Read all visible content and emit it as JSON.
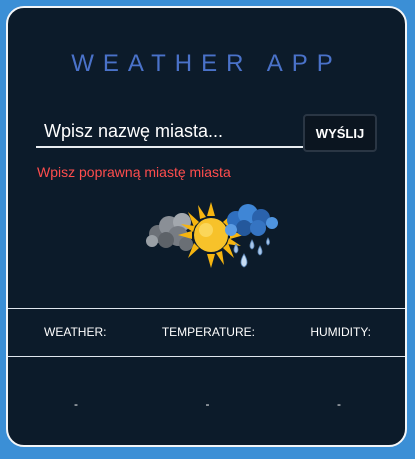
{
  "app": {
    "title": "WEATHER APP"
  },
  "search": {
    "placeholder": "Wpisz nazwę miasta...",
    "value": "",
    "button_label": "WYŚLIJ"
  },
  "error_message": "Wpisz poprawną miastę miasta",
  "weather_icon": {
    "name": "partly-sunny-rain-icon",
    "colors": {
      "sun": "#f6b510",
      "cloud_grey": "#8a8f96",
      "cloud_blue": "#2f6fbf",
      "rain": "#a9c6e8"
    }
  },
  "stats": {
    "labels": [
      "WEATHER:",
      "TEMPERATURE:",
      "HUMIDITY:"
    ],
    "values": [
      "-",
      "-",
      "-"
    ]
  },
  "colors": {
    "background": "#3b8fd6",
    "panel": "#0c1b2a",
    "title": "#4a72c9",
    "error": "#ff4d4d"
  }
}
